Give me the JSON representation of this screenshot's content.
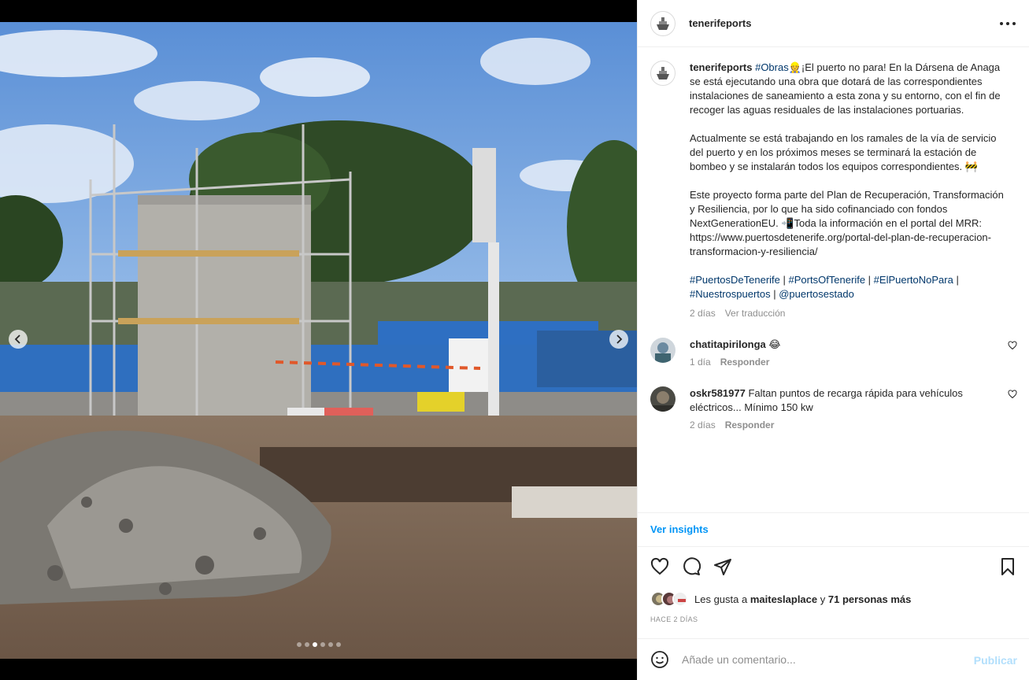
{
  "header": {
    "username": "tenerifeports",
    "avatar_icon": "ship-icon",
    "more_icon": "more-options-icon"
  },
  "media": {
    "slide_count": 6,
    "active_slide": 3,
    "prev_icon": "chevron-left-icon",
    "next_icon": "chevron-right-icon"
  },
  "caption": {
    "username": "tenerifeports",
    "hashtag_obras": "#Obras",
    "p1": "👷¡El puerto no para! En la Dársena de Anaga se está ejecutando una obra que dotará de las correspondientes instalaciones de saneamiento a esta zona y su entorno, con el fin de recoger las aguas residuales de las instalaciones portuarias.",
    "p2": "Actualmente se está trabajando en los ramales de la vía de servicio del puerto y en los próximos meses se terminará la estación de bombeo y se instalarán todos los equipos correspondientes. 🚧",
    "p3": "Este proyecto forma parte del Plan de Recuperación, Transformación y Resiliencia, por lo que ha sido cofinanciado con fondos NextGenerationEU. 📲Toda la información en el portal del MRR: https://www.puertosdetenerife.org/portal-del-plan-de-recuperacion-transformacion-y-resiliencia/",
    "tags": [
      "#PuertosDeTenerife",
      "#PortsOfTenerife",
      "#ElPuertoNoPara",
      "#Nuestrospuertos",
      "@puertosestado"
    ],
    "separator": " | ",
    "time": "2 días",
    "translate": "Ver traducción"
  },
  "comments": [
    {
      "username": "chatitapirilonga",
      "text": "😂",
      "time": "1 día",
      "reply": "Responder"
    },
    {
      "username": "oskr581977",
      "text": "Faltan puntos de recarga rápida para vehículos eléctricos... Mínimo 150 kw",
      "time": "2 días",
      "reply": "Responder"
    }
  ],
  "insights_label": "Ver insights",
  "likes": {
    "prefix": "Les gusta a",
    "user": "maiteslaplace",
    "joiner": "y",
    "others": "71 personas más"
  },
  "timeago": "HACE 2 DÍAS",
  "add_comment": {
    "placeholder": "Añade un comentario...",
    "publish": "Publicar"
  },
  "colors": {
    "link": "#00376b",
    "accent": "#0095f6",
    "muted": "#8e8e8e",
    "publish_disabled": "#b2dffc"
  }
}
